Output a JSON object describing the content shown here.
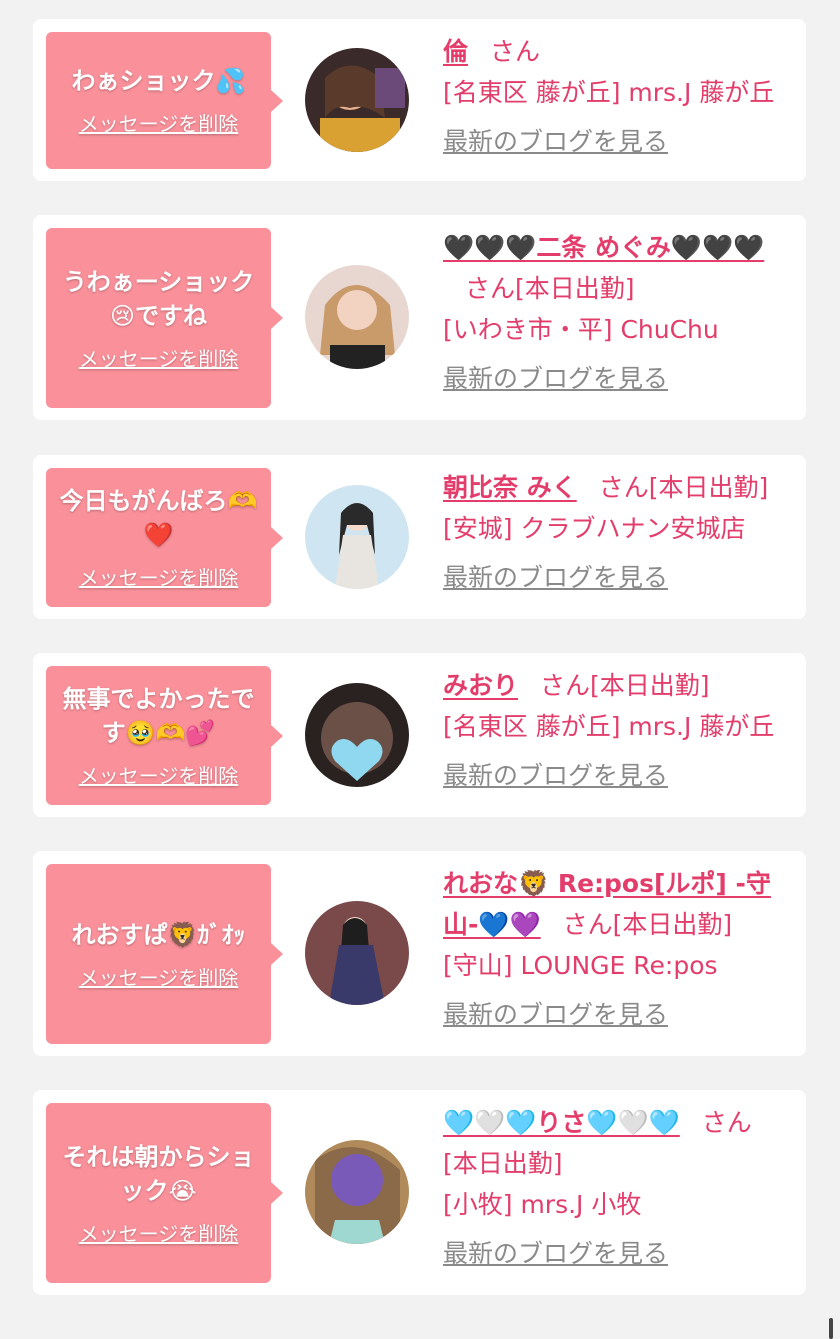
{
  "delete_label": "メッセージを削除",
  "blog_label": "最新のブログを見る",
  "san_label": "さん",
  "cards": [
    {
      "message": "わぁショック💦",
      "name": "倫",
      "status": "",
      "shop": "[名東区 藤が丘] mrs.J 藤が丘"
    },
    {
      "message": "うわぁーショック😢ですね",
      "name": "🖤🖤🖤二条 めぐみ🖤🖤🖤",
      "status": "[本日出勤]",
      "shop": "[いわき市・平] ChuChu"
    },
    {
      "message": "今日もがんばろ🫶❤️",
      "name": "朝比奈 みく",
      "status": "[本日出勤]",
      "shop": "[安城] クラブハナン安城店"
    },
    {
      "message": "無事でよかったです🥹🫶💕",
      "name": "みおり",
      "status": "[本日出勤]",
      "shop": "[名東区 藤が丘] mrs.J 藤が丘"
    },
    {
      "message": "れおすぱ🦁ｶﾞｵｯ",
      "name": "れおな🦁 Re:pos[ルポ] -守山-💙💜",
      "status": "[本日出勤]",
      "shop": "[守山] LOUNGE Re:pos"
    },
    {
      "message": "それは朝からショック😭",
      "name": "🩵🤍🩵りさ🩵🤍🩵",
      "status": "[本日出勤]",
      "shop": "[小牧] mrs.J 小牧"
    }
  ],
  "colors": {
    "accent": "#e33d6b",
    "bubble": "#f9909a",
    "background": "#f2f2f2"
  }
}
